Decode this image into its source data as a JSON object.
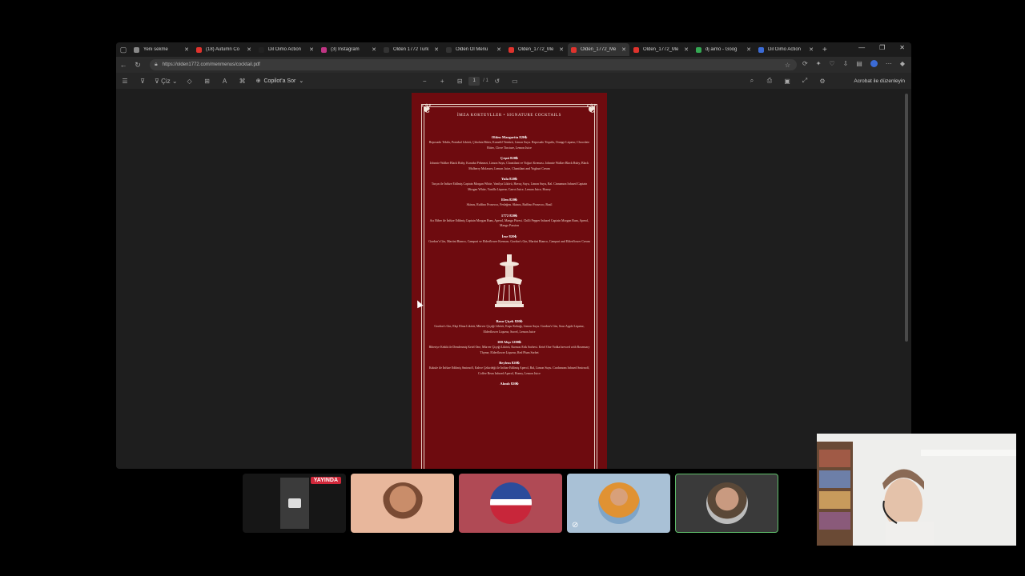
{
  "browser": {
    "tabs": [
      {
        "label": "Yeni sekme",
        "color": "#888888",
        "active": false
      },
      {
        "label": "(18) Autumn Co",
        "color": "#e0332d",
        "active": false
      },
      {
        "label": "Dil Oimo Action",
        "color": "#222222",
        "active": false
      },
      {
        "label": "(3) Instagram",
        "color": "#c13584",
        "active": false
      },
      {
        "label": "Olden 1772 Turk",
        "color": "#333333",
        "active": false
      },
      {
        "label": "Olden Öl Menü",
        "color": "#333333",
        "active": false
      },
      {
        "label": "Olden_1772_Me",
        "color": "#e0332d",
        "active": false
      },
      {
        "label": "Olden_1772_Me",
        "color": "#e0332d",
        "active": true
      },
      {
        "label": "Olden_1772_Me",
        "color": "#e0332d",
        "active": false
      },
      {
        "label": "dj aimo - Goog",
        "color": "#34a853",
        "active": false
      },
      {
        "label": "Dil Oimo Action",
        "color": "#3b6bd6",
        "active": false
      }
    ],
    "url": "https://olden1772.com/menmenus/cocktail.pdf"
  },
  "pdf_toolbar": {
    "draw_label": "Çiz",
    "copilot_label": "Copilot'a Sor",
    "page_current": "1",
    "page_total": "/ 1",
    "acrobat_label": "Acrobat ile düzenleyin"
  },
  "menu": {
    "title": "İMZA KOKTEYLLER • SIGNATURE COCKTAILS",
    "items": [
      {
        "name": "Olden Margarita 820₺",
        "desc": "Reposado Tekila, Portakal Likörü, Çikolata Bitter, Kamelif Tentürü, Limon Suyu. Reposado Tequila, Orange Liqueur, Chocolate Bitter, Clove Tincture, Lemon Juice"
      },
      {
        "name": "Çeşni 820₺",
        "desc": "Johnnie Walker Black Ruby, Karadut Pekmezi, Limon Suyu, Chantilant ve Yoğurt Kreması. Johnnie Walker Black Ruby, Black Mulberry Molasses, Lemon Juice, Chantilant and Yoghurt Cream"
      },
      {
        "name": "Yula 820₺",
        "desc": "Tarçın ile İnfüze Edilmiş Captain Morgan White, Vanilya Likörü, Havuç Suyu, Limon Suyu, Bal. Cinnamon Infused Captain Morgan White, Vanilla Liqueur, Carrot Juice, Lemon Juice, Honey"
      },
      {
        "name": "Elen 820₺",
        "desc": "Skinos, Ruffino Prosecco, Fesleğen. Skinos, Ruffino Prosecco, Basil"
      },
      {
        "name": "1772 820₺",
        "desc": "Acı Biber ile İnfüze Edilmiş Captain Morgan Rum, Aperol, Mango Püresi. Chilli Pepper Infused Captain Morgan Rum, Aperol, Mango Passion"
      },
      {
        "name": "İrse 820₺",
        "desc": "Gordon's Gin, Martini Bianco, Campari ve Elderflower Kreması. Gordon's Gin, Martini Bianco, Campari and Elderflower Cream"
      }
    ],
    "items_after": [
      {
        "name": "Basu Çiçek 820₺",
        "desc": "Gordon's Gin, Ekşi Elma Likörü, Mürver Çiçeği Likörü, Kuşu Kokağı, Limon Suyu. Gordon's Gin, Sour Apple Liqueur, Elderflower Liqueur, Sorrel, Lemon Juice"
      },
      {
        "name": "100 Akşı 1200₺",
        "desc": "Biberiye Kekik ile Demlenmiş Ketel One, Mürver Çiçeği Likörü, Kırmızı Erik Sorbesi. Ketel One Vodka brewed with Rosemary Thyme, Elderflower Liqueur, Red Plum Sorbet"
      },
      {
        "name": "Beylem 820₺",
        "desc": "Kakule ile İnfüze Edilmiş Smirnoff, Kahve Çekirdeği ile İnfüze Edilmiş Aperol, Bal, Limon Suyu. Cardamom Infused Smirnoff, Coffee Bean Infused Aperol, Honey, Lemon Juice"
      },
      {
        "name": "Alımlı 820₺",
        "desc": ""
      }
    ]
  },
  "call": {
    "live_label": "YAYINDA",
    "participants": [
      {
        "name": "screen-share",
        "bg": "#1a1a1a"
      },
      {
        "name": "participant-1",
        "bg": "#e8b79c"
      },
      {
        "name": "participant-2",
        "bg": "#b04a55"
      },
      {
        "name": "participant-3",
        "bg": "#9fb8d0"
      },
      {
        "name": "participant-4",
        "bg": "#3a3a3a"
      }
    ]
  }
}
